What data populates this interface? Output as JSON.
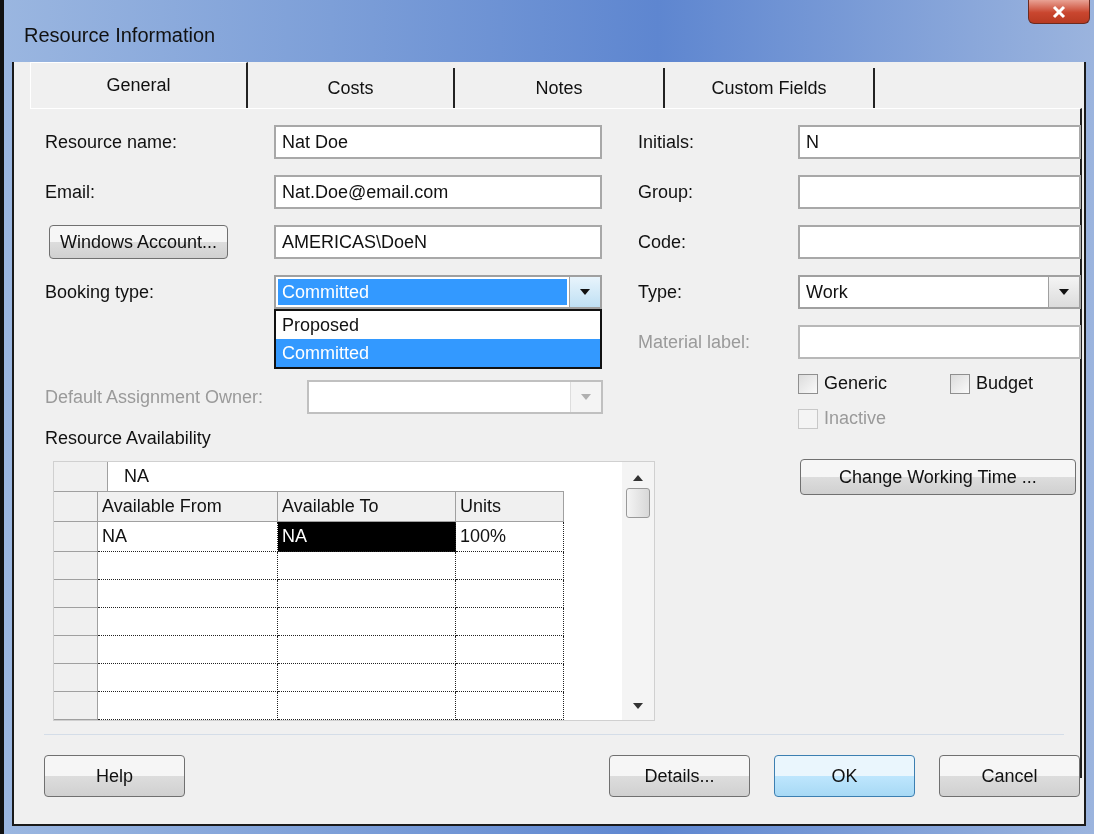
{
  "window": {
    "title": "Resource Information"
  },
  "tabs": [
    {
      "label": "General",
      "selected": true
    },
    {
      "label": "Costs",
      "selected": false
    },
    {
      "label": "Notes",
      "selected": false
    },
    {
      "label": "Custom Fields",
      "selected": false
    }
  ],
  "left_fields": [
    {
      "kind": "text",
      "label": "Resource name:",
      "value": "Nat Doe"
    },
    {
      "kind": "text",
      "label": "Email:",
      "value": "Nat.Doe@email.com"
    },
    {
      "kind": "button",
      "label": "Windows Account...",
      "value": "AMERICAS\\DoeN"
    },
    {
      "kind": "dropdown",
      "label": "Booking type:",
      "value": "Committed",
      "focused": true,
      "expanded": true,
      "options": [
        {
          "label": "Proposed",
          "selected": false
        },
        {
          "label": "Committed",
          "selected": true
        }
      ]
    },
    {
      "kind": "dropdown",
      "label": "Default Assignment Owner:",
      "disabled": true
    }
  ],
  "right_fields": [
    {
      "kind": "text",
      "label": "Initials:",
      "value": "N"
    },
    {
      "kind": "text",
      "label": "Group:"
    },
    {
      "kind": "text",
      "label": "Code:"
    },
    {
      "kind": "dropdown",
      "label": "Type:",
      "value": "Work"
    },
    {
      "kind": "text",
      "label": "Material label:",
      "disabled": true
    }
  ],
  "checkboxes": [
    {
      "label": "Generic",
      "checked": false,
      "disabled": false
    },
    {
      "label": "Budget",
      "checked": false,
      "disabled": false
    },
    {
      "label": "Inactive",
      "checked": false,
      "disabled": true
    }
  ],
  "availability": {
    "title": "Resource Availability",
    "header_value": "NA",
    "columns": [
      "Available From",
      "Available To",
      "Units"
    ],
    "rows": [
      [
        {
          "text": "NA",
          "selected": false
        },
        {
          "text": "NA",
          "selected": true
        },
        {
          "text": "100%",
          "selected": false
        }
      ]
    ]
  },
  "change_working_time": "Change Working Time ...",
  "footer_buttons": [
    {
      "label": "Help",
      "default": false
    },
    {
      "label": "Details...",
      "default": false
    },
    {
      "label": "OK",
      "default": true
    },
    {
      "label": "Cancel",
      "default": false
    }
  ]
}
